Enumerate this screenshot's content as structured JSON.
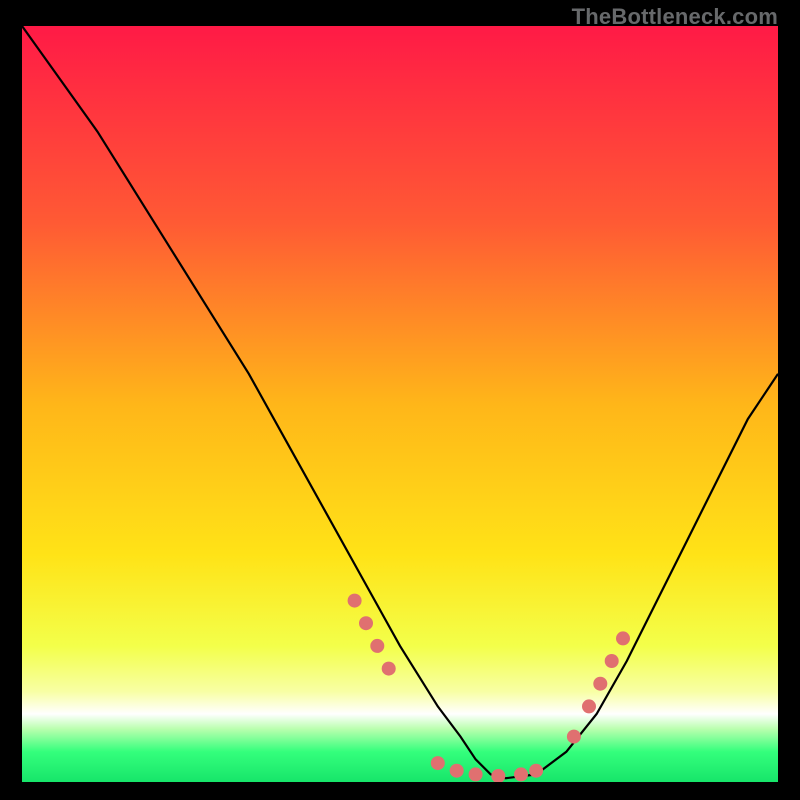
{
  "watermark": "TheBottleneck.com",
  "chart_data": {
    "type": "line",
    "title": "",
    "xlabel": "",
    "ylabel": "",
    "xlim": [
      0,
      100
    ],
    "ylim": [
      0,
      100
    ],
    "grid": false,
    "legend": false,
    "gradient_bands": [
      {
        "color": "#ff1a46",
        "y_top": 100,
        "y_bottom": 80
      },
      {
        "color": "#ff6a2e",
        "y_top": 80,
        "y_bottom": 55
      },
      {
        "color": "#ffd21a",
        "y_top": 55,
        "y_bottom": 22
      },
      {
        "color": "#f7ff6a",
        "y_top": 22,
        "y_bottom": 12
      },
      {
        "color": "#2fff78",
        "y_top": 7,
        "y_bottom": 0
      }
    ],
    "series": [
      {
        "name": "bottleneck-curve",
        "x": [
          0,
          5,
          10,
          15,
          20,
          25,
          30,
          35,
          40,
          45,
          50,
          55,
          58,
          60,
          62,
          64,
          68,
          72,
          76,
          80,
          84,
          88,
          92,
          96,
          100
        ],
        "y": [
          100,
          93,
          86,
          78,
          70,
          62,
          54,
          45,
          36,
          27,
          18,
          10,
          6,
          3,
          1,
          0.5,
          1,
          4,
          9,
          16,
          24,
          32,
          40,
          48,
          54
        ]
      }
    ],
    "markers": {
      "name": "valley-dots",
      "color": "#e07070",
      "radius": 7,
      "points": [
        {
          "x": 44,
          "y": 24
        },
        {
          "x": 45.5,
          "y": 21
        },
        {
          "x": 47,
          "y": 18
        },
        {
          "x": 48.5,
          "y": 15
        },
        {
          "x": 55,
          "y": 2.5
        },
        {
          "x": 57.5,
          "y": 1.5
        },
        {
          "x": 60,
          "y": 1.0
        },
        {
          "x": 63,
          "y": 0.8
        },
        {
          "x": 66,
          "y": 1.0
        },
        {
          "x": 68,
          "y": 1.5
        },
        {
          "x": 73,
          "y": 6
        },
        {
          "x": 75,
          "y": 10
        },
        {
          "x": 76.5,
          "y": 13
        },
        {
          "x": 78,
          "y": 16
        },
        {
          "x": 79.5,
          "y": 19
        }
      ]
    }
  }
}
